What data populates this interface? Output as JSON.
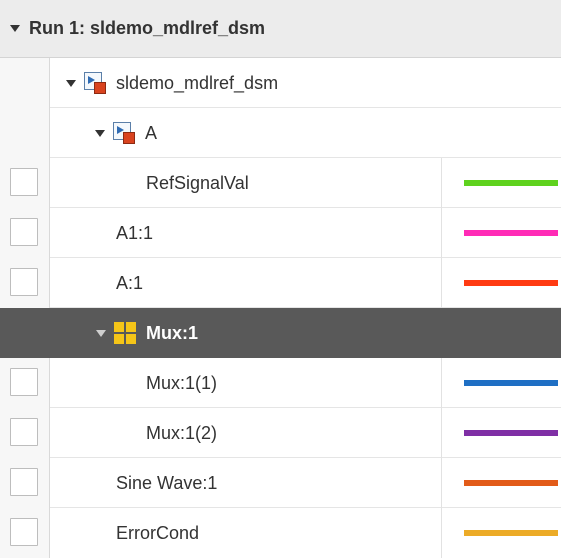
{
  "run": {
    "title": "Run 1: sldemo_mdlref_dsm"
  },
  "tree": {
    "model": {
      "label": "sldemo_mdlref_dsm",
      "icon": "model-reference-icon"
    },
    "submodel": {
      "label": "A",
      "icon": "model-reference-icon"
    }
  },
  "signals": [
    {
      "label": "RefSignalVal",
      "color": "#5fd21e"
    },
    {
      "label": "A1:1",
      "color": "#ff2bb6"
    },
    {
      "label": "A:1",
      "color": "#ff3b12"
    },
    {
      "label": "Mux:1",
      "color": "",
      "selected": true,
      "icon": "mux-icon"
    },
    {
      "label": "Mux:1(1)",
      "color": "#1f6fc4"
    },
    {
      "label": "Mux:1(2)",
      "color": "#7f2fa5"
    },
    {
      "label": "Sine Wave:1",
      "color": "#e25b19"
    },
    {
      "label": "ErrorCond",
      "color": "#ecab27"
    }
  ]
}
